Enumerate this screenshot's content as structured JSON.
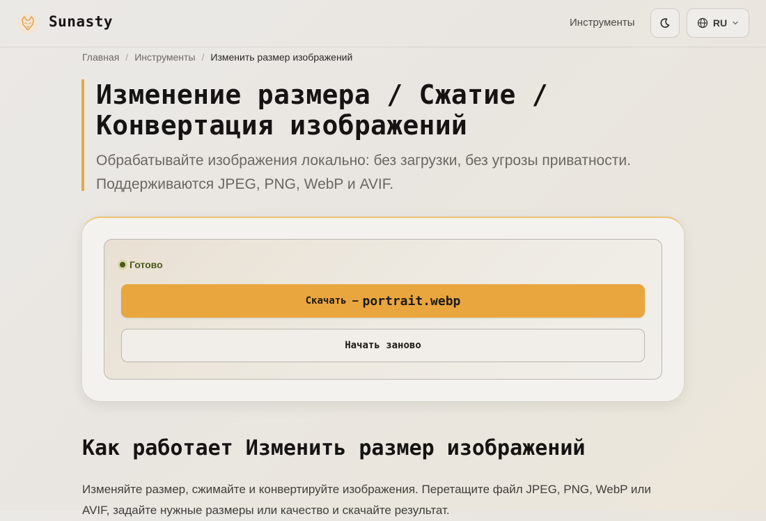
{
  "header": {
    "brand": "Sunasty",
    "nav_tools": "Инструменты",
    "theme_icon": "moon-icon",
    "language": "RU",
    "language_icon": "globe-icon"
  },
  "breadcrumb": {
    "home": "Главная",
    "tools": "Инструменты",
    "current": "Изменить размер изображений",
    "separator": "/"
  },
  "hero": {
    "title_line1": "Изменение размера / Сжатие /",
    "title_line2": "Конвертация изображений",
    "subtitle": "Обрабатывайте изображения локально: без загрузки, без угрозы приватности. Поддерживаются JPEG, PNG, WebP и AVIF."
  },
  "result": {
    "status": "Готово",
    "download_label": "Скачать —",
    "download_file": "portrait.webp",
    "restart_label": "Начать заново"
  },
  "how_it_works": {
    "title": "Как работает Изменить размер изображений",
    "text": "Изменяйте размер, сжимайте и конвертируйте изображения. Перетащите файл JPEG, PNG, WebP или AVIF, задайте нужные размеры или качество и скачайте результат."
  },
  "colors": {
    "accent": "#e9a63e",
    "status": "#4a5a1a"
  }
}
